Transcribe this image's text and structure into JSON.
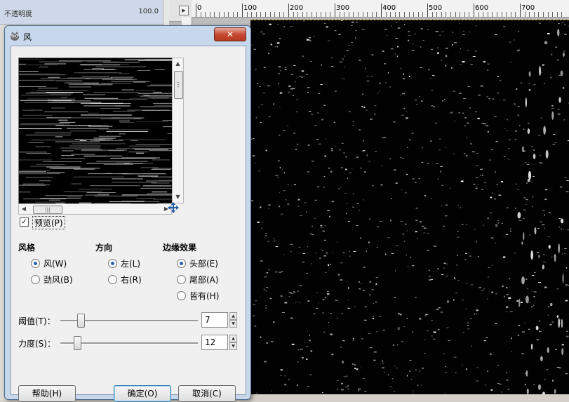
{
  "background": {
    "opacity_label": "不透明度",
    "opacity_value": "100.0",
    "ruler_ticks": [
      "0",
      "100",
      "200",
      "300",
      "400",
      "500",
      "600",
      "700"
    ]
  },
  "dialog": {
    "title": "风",
    "close_label": "✕",
    "preview_check": "✓",
    "preview_label": "预览(P)",
    "groups": {
      "style": {
        "title": "风格",
        "options": [
          "风(W)",
          "劲风(B)"
        ]
      },
      "direction": {
        "title": "方向",
        "options": [
          "左(L)",
          "右(R)"
        ]
      },
      "edge": {
        "title": "边缘效果",
        "options": [
          "头部(E)",
          "尾部(A)",
          "皆有(H)"
        ]
      }
    },
    "threshold": {
      "label": "阈值(T)：",
      "value": "7"
    },
    "strength": {
      "label": "力度(S)：",
      "value": "12"
    },
    "buttons": {
      "help": "帮助(H)",
      "ok": "确定(O)",
      "cancel": "取消(C)"
    }
  },
  "colors": {
    "accent": "#2764b0",
    "close": "#c74b33",
    "canvas": "#020202"
  }
}
